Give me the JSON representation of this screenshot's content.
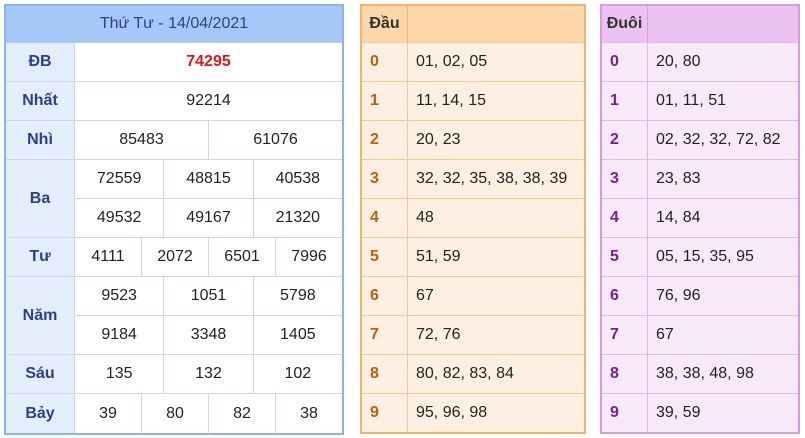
{
  "results": {
    "title": "Thứ Tư - 14/04/2021",
    "db_label": "ĐB",
    "db": [
      "74295"
    ],
    "nhat_label": "Nhất",
    "nhat": [
      "92214"
    ],
    "nhi_label": "Nhì",
    "nhi": [
      "85483",
      "61076"
    ],
    "ba_label": "Ba",
    "ba": [
      [
        "72559",
        "48815",
        "40538"
      ],
      [
        "49532",
        "49167",
        "21320"
      ]
    ],
    "tu_label": "Tư",
    "tu": [
      "4111",
      "2072",
      "6501",
      "7996"
    ],
    "nam_label": "Năm",
    "nam": [
      [
        "9523",
        "1051",
        "5798"
      ],
      [
        "9184",
        "3348",
        "1405"
      ]
    ],
    "sau_label": "Sáu",
    "sau": [
      "135",
      "132",
      "102"
    ],
    "bay_label": "Bảy",
    "bay": [
      "39",
      "80",
      "82",
      "38"
    ]
  },
  "dau": {
    "header": "Đầu",
    "rows": [
      {
        "k": "0",
        "v": "01, 02, 05"
      },
      {
        "k": "1",
        "v": "11, 14, 15"
      },
      {
        "k": "2",
        "v": "20, 23"
      },
      {
        "k": "3",
        "v": "32, 32, 35, 38, 38, 39"
      },
      {
        "k": "4",
        "v": "48"
      },
      {
        "k": "5",
        "v": "51, 59"
      },
      {
        "k": "6",
        "v": "67"
      },
      {
        "k": "7",
        "v": "72, 76"
      },
      {
        "k": "8",
        "v": "80, 82, 83, 84"
      },
      {
        "k": "9",
        "v": "95, 96, 98"
      }
    ]
  },
  "duoi": {
    "header": "Đuôi",
    "rows": [
      {
        "k": "0",
        "v": "20, 80"
      },
      {
        "k": "1",
        "v": "01, 11, 51"
      },
      {
        "k": "2",
        "v": "02, 32, 32, 72, 82"
      },
      {
        "k": "3",
        "v": "23, 83"
      },
      {
        "k": "4",
        "v": "14, 84"
      },
      {
        "k": "5",
        "v": "05, 15, 35, 95"
      },
      {
        "k": "6",
        "v": "76, 96"
      },
      {
        "k": "7",
        "v": "67"
      },
      {
        "k": "8",
        "v": "38, 38, 48, 98"
      },
      {
        "k": "9",
        "v": "39, 59"
      }
    ]
  }
}
